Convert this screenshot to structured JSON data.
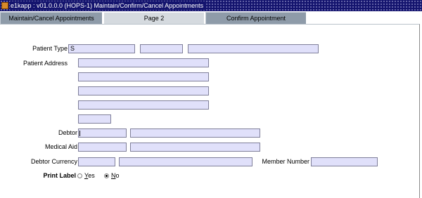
{
  "window": {
    "title": "e1kapp : v01.0.0.0 (HOPS-1) Maintain/Confirm/Cancel Appointments",
    "icon": "app-icon"
  },
  "tabs": [
    {
      "label": "Maintain/Cancel Appointments",
      "active": false
    },
    {
      "label": "Page 2",
      "active": true
    },
    {
      "label": "Confirm Appointment",
      "active": false
    }
  ],
  "form": {
    "patient_type": {
      "label": "Patient Type",
      "values": [
        "S",
        "",
        ""
      ]
    },
    "patient_address": {
      "label": "Patient Address",
      "lines": [
        "",
        "",
        "",
        "",
        "",
        ""
      ]
    },
    "debtor": {
      "label": "Debtor",
      "code": "",
      "name": ""
    },
    "medical_aid": {
      "label": "Medical Aid",
      "code": "",
      "name": ""
    },
    "debtor_currency": {
      "label": "Debtor Currency",
      "code": "",
      "name": ""
    },
    "member_number": {
      "label": "Member Number",
      "value": ""
    },
    "print_label": {
      "label": "Print Label",
      "options": [
        {
          "mnemonic": "Y",
          "rest": "es",
          "selected": false
        },
        {
          "mnemonic": "N",
          "rest": "o",
          "selected": true
        }
      ]
    }
  },
  "colors": {
    "title_bar": "#14146e",
    "field_bg": "#e0e0fa",
    "tab_inactive": "#8e9ba9",
    "tab_active": "#d5dadf"
  }
}
